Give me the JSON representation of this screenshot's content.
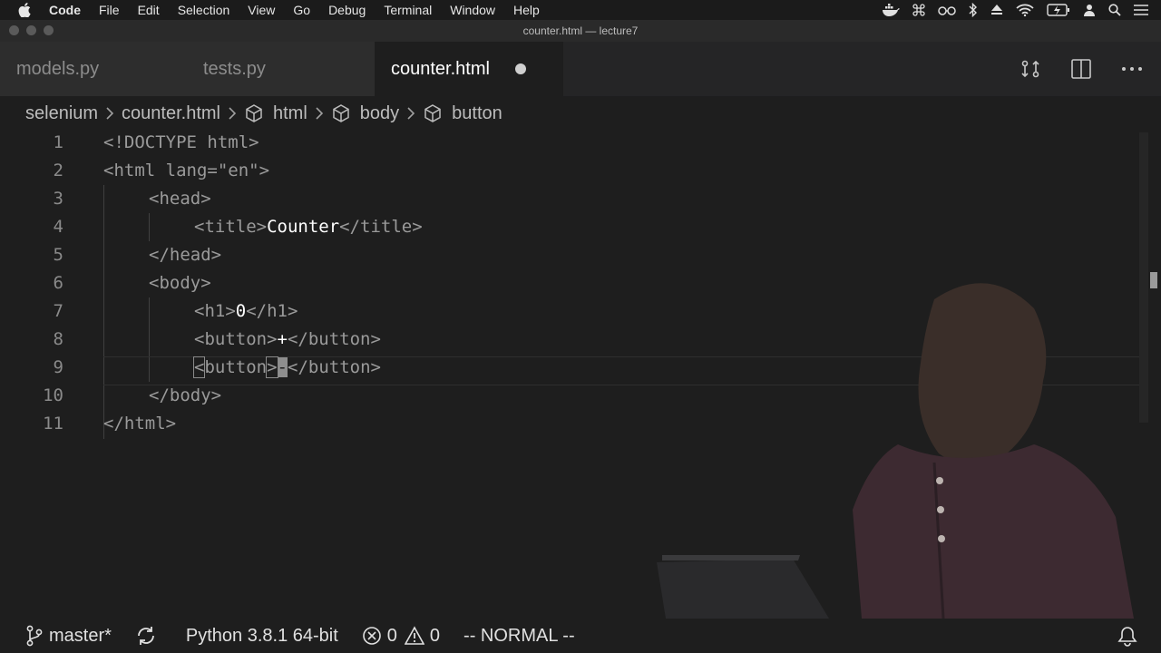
{
  "menubar": {
    "app": "Code",
    "items": [
      "File",
      "Edit",
      "Selection",
      "View",
      "Go",
      "Debug",
      "Terminal",
      "Window",
      "Help"
    ]
  },
  "window": {
    "title": "counter.html — lecture7"
  },
  "tabs": [
    {
      "label": "models.py",
      "active": false
    },
    {
      "label": "tests.py",
      "active": false
    },
    {
      "label": "counter.html",
      "active": true,
      "modified": true
    }
  ],
  "breadcrumb": [
    "selenium",
    "counter.html",
    "html",
    "body",
    "button"
  ],
  "editor": {
    "lines": [
      {
        "num": "1",
        "text": "<!DOCTYPE html>"
      },
      {
        "num": "2",
        "text": "<html lang=\"en\">"
      },
      {
        "num": "3",
        "text": "<head>"
      },
      {
        "num": "4",
        "open": "<title>",
        "content": "Counter",
        "close": "</title>"
      },
      {
        "num": "5",
        "text": "</head>"
      },
      {
        "num": "6",
        "text": "<body>"
      },
      {
        "num": "7",
        "open": "<h1>",
        "content": "0",
        "close": "</h1>"
      },
      {
        "num": "8",
        "open": "<button>",
        "content": "+",
        "close": "</button>"
      },
      {
        "num": "9",
        "open_lt": "<",
        "open_rest": "button",
        "open_gt": ">",
        "content": "-",
        "close": "</button>"
      },
      {
        "num": "10",
        "text": "</body>"
      },
      {
        "num": "11",
        "text": "</html>"
      }
    ]
  },
  "statusbar": {
    "branch": "master*",
    "python": "Python 3.8.1 64-bit",
    "errors": "0",
    "warnings": "0",
    "mode": "-- NORMAL --"
  },
  "colors": {
    "background": "#1e1e1e",
    "tab_inactive": "#2d2d2d",
    "text": "#d4d4d4"
  }
}
